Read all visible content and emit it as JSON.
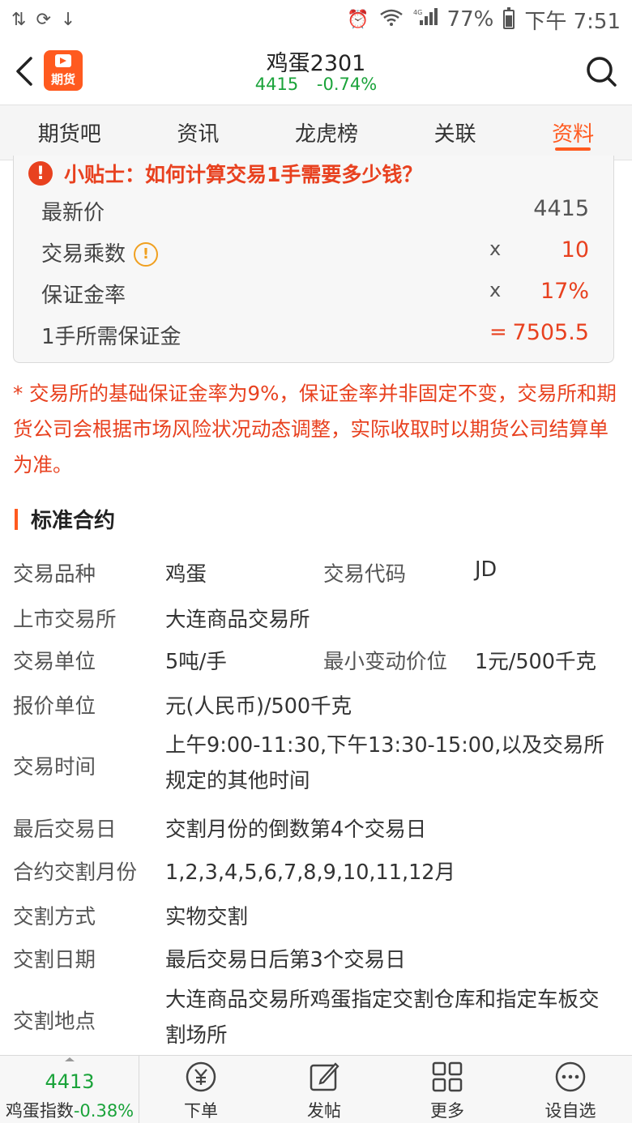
{
  "status_bar": {
    "battery": "77%",
    "time": "下午 7:51",
    "signal_label": "4G"
  },
  "header": {
    "title": "鸡蛋2301",
    "price": "4415",
    "change": "-0.74%",
    "logo_text": "期货"
  },
  "tabs": [
    {
      "label": "期货吧",
      "active": false
    },
    {
      "label": "资讯",
      "active": false
    },
    {
      "label": "龙虎榜",
      "active": false
    },
    {
      "label": "关联",
      "active": false
    },
    {
      "label": "资料",
      "active": true
    }
  ],
  "tip": {
    "title": "小贴士：如何计算交易1手需要多少钱？",
    "rows": [
      {
        "label": "最新价",
        "op": "",
        "value": "4415"
      },
      {
        "label": "交易乘数",
        "op": "x",
        "value": "10"
      },
      {
        "label": "保证金率",
        "op": "x",
        "value": "17%"
      },
      {
        "label": "1手所需保证金",
        "op": "=",
        "value": "7505.5"
      }
    ]
  },
  "note": "* 交易所的基础保证金率为9%，保证金率并非固定不变，交易所和期货公司会根据市场风险状况动态调整，实际收取时以期货公司结算单为准。",
  "contract": {
    "title": "标准合约",
    "rows": [
      {
        "key": "交易品种",
        "value": "鸡蛋",
        "key2": "交易代码",
        "value2": "JD"
      },
      {
        "key": "上市交易所",
        "value": "大连商品交易所"
      },
      {
        "key": "交易单位",
        "value": "5吨/手",
        "key2": "最小变动价位",
        "value2": "1元/500千克"
      },
      {
        "key": "报价单位",
        "value": "元(人民币)/500千克"
      },
      {
        "key": "交易时间",
        "value": "上午9:00-11:30,下午13:30-15:00,以及交易所规定的其他时间"
      },
      {
        "key": "最后交易日",
        "value": "交割月份的倒数第4个交易日"
      },
      {
        "key": "合约交割月份",
        "value": "1,2,3,4,5,6,7,8,9,10,11,12月"
      },
      {
        "key": "交割方式",
        "value": "实物交割"
      },
      {
        "key": "交割日期",
        "value": "最后交易日后第3个交易日"
      },
      {
        "key": "交割地点",
        "value": "大连商品交易所鸡蛋指定交割仓库和指定车板交割场所"
      }
    ]
  },
  "bottom_bar": {
    "index_price": "4413",
    "index_name": "鸡蛋指数",
    "index_change": "-0.38%",
    "items": [
      {
        "label": "下单",
        "icon": "yuan-circle-icon"
      },
      {
        "label": "发帖",
        "icon": "edit-icon"
      },
      {
        "label": "更多",
        "icon": "grid-icon"
      },
      {
        "label": "设自选",
        "icon": "more-circle-icon"
      }
    ]
  },
  "colors": {
    "accent": "#ff5a1f",
    "up_down_green": "#1aa33a",
    "alert_red": "#e8411f"
  }
}
